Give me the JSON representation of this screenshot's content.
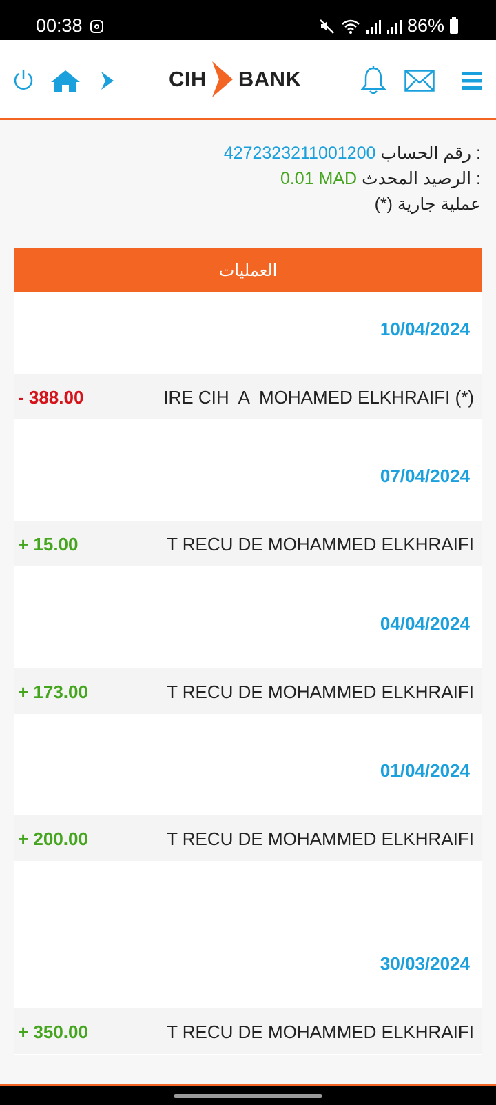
{
  "status_bar": {
    "time": "00:38",
    "battery": "86%",
    "icons": [
      "instagram-icon",
      "mute-icon",
      "wifi-icon",
      "signal-icon",
      "signal-icon",
      "battery-icon"
    ]
  },
  "header": {
    "logo_left": "CIH",
    "logo_right": "BANK",
    "icons": [
      "power-icon",
      "home-icon",
      "forward-icon",
      "bell-icon",
      "mail-icon",
      "menu-icon"
    ]
  },
  "account": {
    "number_label": "رقم الحساب :",
    "number": "4272323211001200",
    "balance_label": "الرصيد المحدث :",
    "balance": "0.01 MAD",
    "pending_note": "عملية جارية (*)"
  },
  "operations": {
    "title": "العمليات",
    "groups": [
      {
        "date": "10/04/2024",
        "amount": "- 388.00",
        "description": "IRE CIH  A  MOHAMED ELKHRAIFI (*)",
        "sign": "negative"
      },
      {
        "date": "07/04/2024",
        "amount": "+ 15.00",
        "description": "T RECU DE MOHAMMED ELKHRAIFI",
        "sign": "positive"
      },
      {
        "date": "04/04/2024",
        "amount": "+ 173.00",
        "description": "T RECU DE MOHAMMED ELKHRAIFI",
        "sign": "positive"
      },
      {
        "date": "01/04/2024",
        "amount": "+ 200.00",
        "description": "T RECU DE MOHAMMED ELKHRAIFI",
        "sign": "positive"
      },
      {
        "date": "30/03/2024",
        "amount": "+ 350.00",
        "description": "T RECU DE MOHAMMED ELKHRAIFI",
        "sign": "positive"
      }
    ]
  },
  "colors": {
    "accent": "#f26522",
    "link_blue": "#1aa0dc",
    "positive": "#46a51f",
    "negative": "#d4141a"
  }
}
